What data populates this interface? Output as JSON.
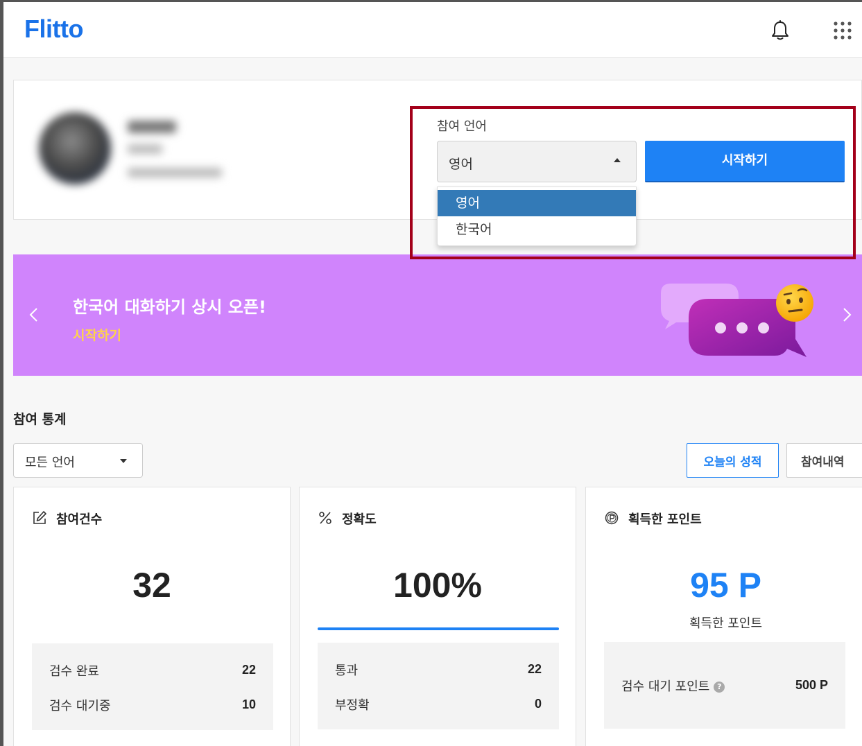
{
  "header": {
    "logo": "Flitto",
    "bell_icon": "bell-icon",
    "apps_icon": "grid-dots-icon"
  },
  "profile": {
    "participation_language_label": "참여 언어",
    "selected_language": "영어",
    "start_button": "시작하기",
    "language_options": [
      "영어",
      "한국어"
    ]
  },
  "banner": {
    "title": "한국어 대화하기 상시 오픈!",
    "cta": "시작하기",
    "bg_color": "#d084fc"
  },
  "stats": {
    "title": "참여 통계",
    "language_filter": "모든 언어",
    "today_button": "오늘의 성적",
    "history_button": "참여내역",
    "cards": {
      "participation": {
        "title": "참여건수",
        "value": "32",
        "rows": [
          {
            "label": "검수 완료",
            "value": "22"
          },
          {
            "label": "검수 대기중",
            "value": "10"
          }
        ]
      },
      "accuracy": {
        "title": "정확도",
        "value": "100%",
        "progress_percent": 100,
        "rows": [
          {
            "label": "통과",
            "value": "22"
          },
          {
            "label": "부정확",
            "value": "0"
          }
        ]
      },
      "points": {
        "title": "획득한 포인트",
        "value": "95 P",
        "sub_label": "획득한 포인트",
        "pending_label": "검수 대기 포인트",
        "pending_value": "500 P"
      }
    }
  },
  "colors": {
    "accent": "#1e82f5",
    "highlight": "#a3001a",
    "dropdown_selected": "#337ab7"
  }
}
